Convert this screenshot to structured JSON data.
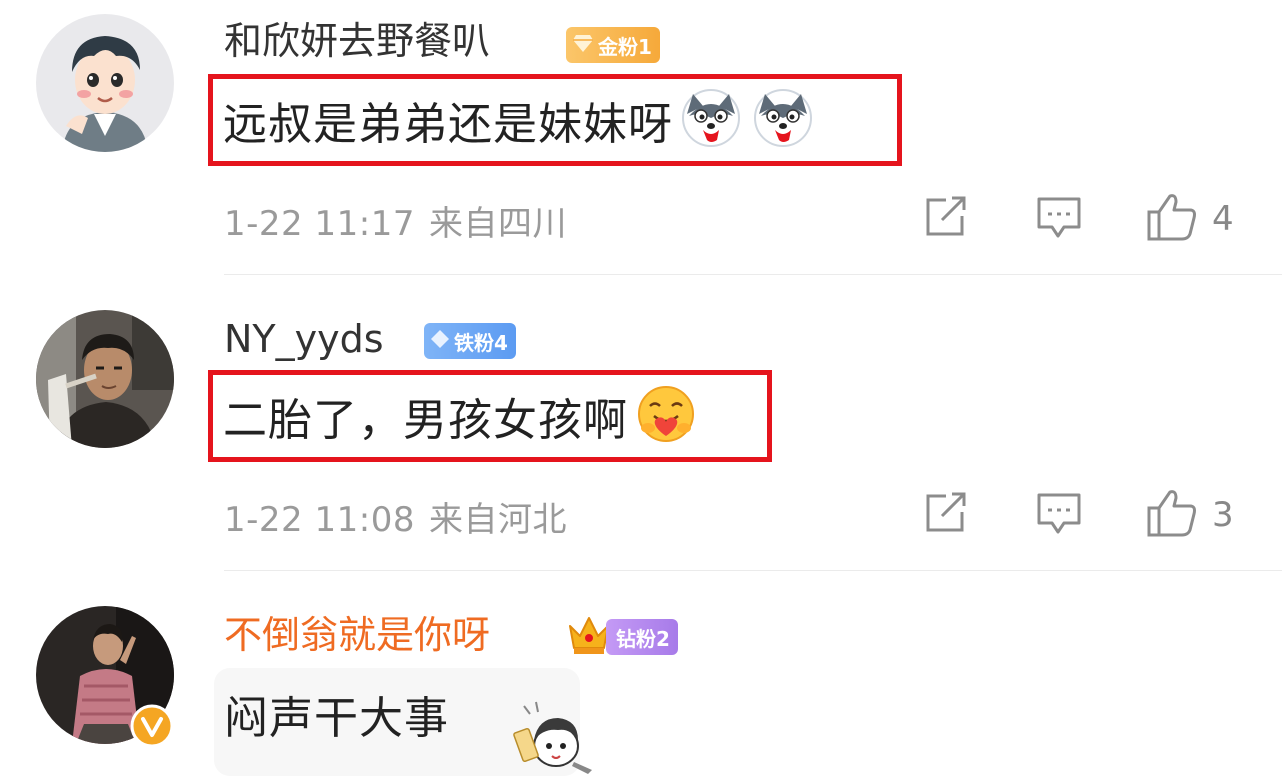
{
  "comments": [
    {
      "username": "和欣妍去野餐叭",
      "badge": "金粉1",
      "text": "远叔是弟弟还是妹妹呀",
      "emoji": [
        "husky-emoji",
        "husky-emoji"
      ],
      "date": "1-22 11:17",
      "location": "来自四川",
      "likes": "4",
      "highlighted": true
    },
    {
      "username": "NY_yyds",
      "badge": "铁粉4",
      "text": "二胎了，男孩女孩啊",
      "emoji": [
        "hug-smile-emoji"
      ],
      "date": "1-22 11:08",
      "location": "来自河北",
      "likes": "3",
      "highlighted": true
    },
    {
      "username": "不倒翁就是你呀",
      "badge": "钻粉2",
      "text": "闷声干大事",
      "verified": true,
      "highlighted": false
    }
  ],
  "icons": [
    "share-icon",
    "comment-icon",
    "like-icon",
    "crown-icon",
    "verified-icon",
    "diamond-icon"
  ],
  "colors": {
    "highlight_border": "#e5141d",
    "orange_username": "#ef6b22",
    "meta_gray": "#9a9a9a",
    "badge_gold": "#f6a93a",
    "badge_iron": "#5c9bf2",
    "badge_diamond": "#a77be9",
    "verified_yellow": "#f5a623"
  }
}
